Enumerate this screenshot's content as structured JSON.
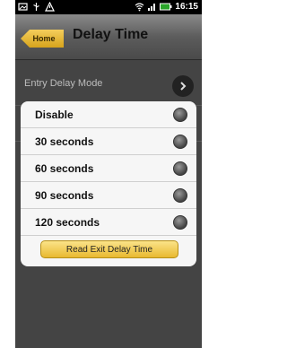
{
  "status_bar": {
    "left_icons": [
      "gallery-icon",
      "usb-icon",
      "warning-icon"
    ],
    "right_icons": [
      "wifi-icon",
      "signal-icon",
      "battery-icon"
    ],
    "time": "16:15"
  },
  "header": {
    "home_label": "Home",
    "title": "Delay Time"
  },
  "main": {
    "entry_delay_label": "Entry Delay Mode"
  },
  "dialog": {
    "options": [
      {
        "label": "Disable"
      },
      {
        "label": "30 seconds"
      },
      {
        "label": "60 seconds"
      },
      {
        "label": "90 seconds"
      },
      {
        "label": "120 seconds"
      }
    ],
    "exit_button_label": "Read Exit Delay Time"
  },
  "colors": {
    "accent": "#e9b930",
    "dialog_bg": "#f6f6f6",
    "screen_bg": "#444444"
  }
}
